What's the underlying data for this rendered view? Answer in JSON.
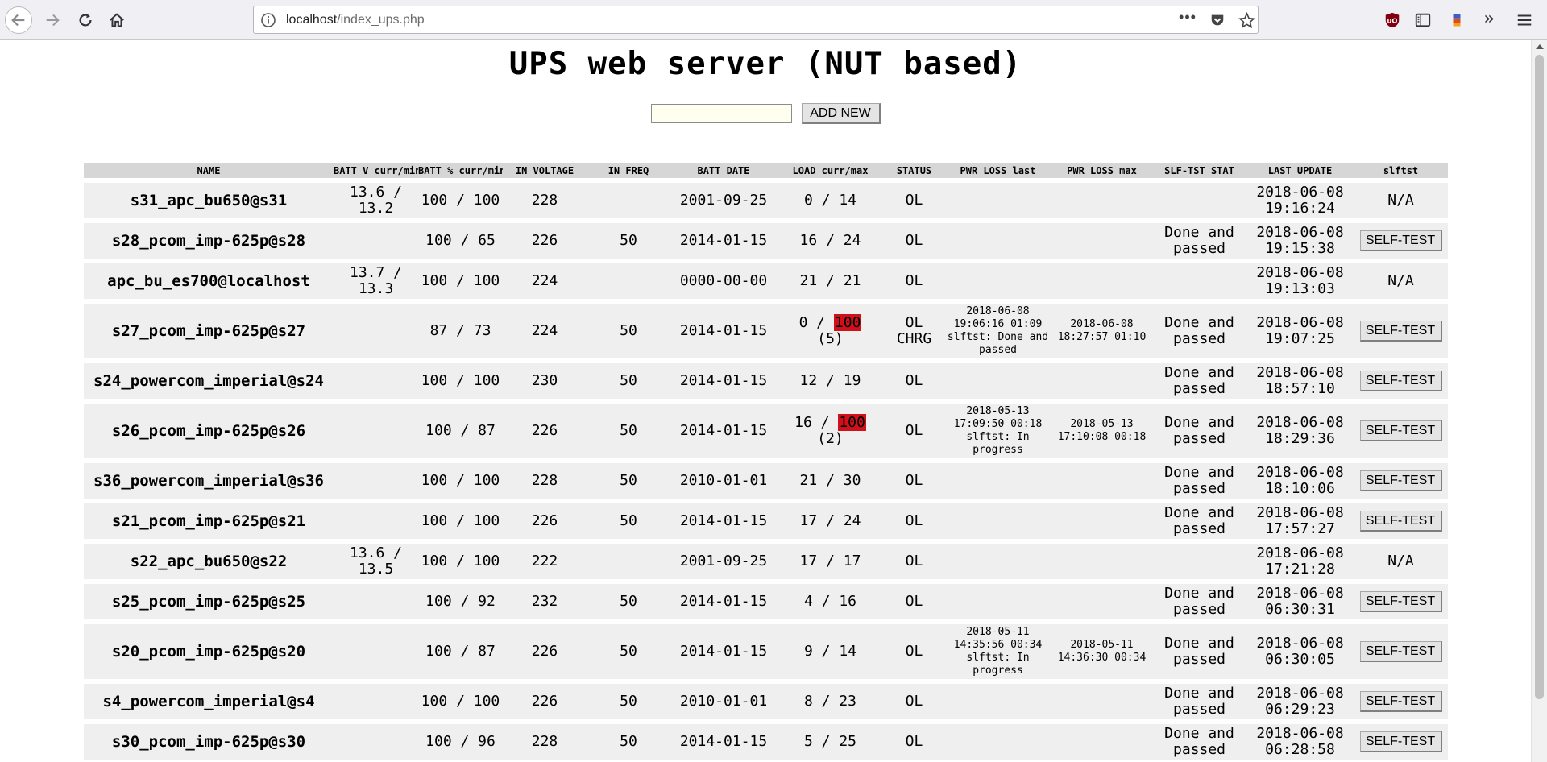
{
  "browser": {
    "url_host": "localhost",
    "url_path": "/index_ups.php"
  },
  "page": {
    "title": "UPS web server (NUT based)",
    "add_input_value": "",
    "add_button": "ADD NEW"
  },
  "columns": [
    "NAME",
    "BATT V curr/min",
    "BATT % curr/min",
    "IN VOLTAGE",
    "IN FREQ",
    "BATT DATE",
    "LOAD curr/max",
    "STATUS",
    "PWR LOSS last",
    "PWR LOSS max",
    "SLF-TST STAT",
    "LAST UPDATE",
    "slftst"
  ],
  "rows": [
    {
      "name": "s31_apc_bu650@s31",
      "batt_v": [
        "13.6 /",
        "13.2"
      ],
      "batt_pct": "100 / 100",
      "in_voltage": "228",
      "in_freq": "",
      "batt_date": "2001-09-25",
      "load_cur": "0",
      "load_max": "14",
      "load_max_alert": false,
      "load_extra": "",
      "status": "OL",
      "pwr_last": [],
      "pwr_max": [],
      "slftst_stat": [],
      "last_update": [
        "2018-06-08",
        "19:16:24"
      ],
      "slftst": "N/A"
    },
    {
      "name": "s28_pcom_imp-625p@s28",
      "batt_v": [],
      "batt_pct": "100 / 65",
      "in_voltage": "226",
      "in_freq": "50",
      "batt_date": "2014-01-15",
      "load_cur": "16",
      "load_max": "24",
      "load_max_alert": false,
      "load_extra": "",
      "status": "OL",
      "pwr_last": [],
      "pwr_max": [],
      "slftst_stat": [
        "Done and",
        "passed"
      ],
      "last_update": [
        "2018-06-08",
        "19:15:38"
      ],
      "slftst": "SELF-TEST"
    },
    {
      "name": "apc_bu_es700@localhost",
      "batt_v": [
        "13.7 /",
        "13.3"
      ],
      "batt_pct": "100 / 100",
      "in_voltage": "224",
      "in_freq": "",
      "batt_date": "0000-00-00",
      "load_cur": "21",
      "load_max": "21",
      "load_max_alert": false,
      "load_extra": "",
      "status": "OL",
      "pwr_last": [],
      "pwr_max": [],
      "slftst_stat": [],
      "last_update": [
        "2018-06-08",
        "19:13:03"
      ],
      "slftst": "N/A"
    },
    {
      "name": "s27_pcom_imp-625p@s27",
      "batt_v": [],
      "batt_pct": "87 / 73",
      "in_voltage": "224",
      "in_freq": "50",
      "batt_date": "2014-01-15",
      "load_cur": "0",
      "load_max": "100",
      "load_max_alert": true,
      "load_extra": "(5)",
      "status": "OL CHRG",
      "pwr_last": [
        "2018-06-08",
        "19:06:16 01:09",
        "slftst: Done and",
        "passed"
      ],
      "pwr_max": [
        "2018-06-08",
        "18:27:57 01:10"
      ],
      "slftst_stat": [
        "Done and",
        "passed"
      ],
      "last_update": [
        "2018-06-08",
        "19:07:25"
      ],
      "slftst": "SELF-TEST"
    },
    {
      "name": "s24_powercom_imperial@s24",
      "batt_v": [],
      "batt_pct": "100 / 100",
      "in_voltage": "230",
      "in_freq": "50",
      "batt_date": "2014-01-15",
      "load_cur": "12",
      "load_max": "19",
      "load_max_alert": false,
      "load_extra": "",
      "status": "OL",
      "pwr_last": [],
      "pwr_max": [],
      "slftst_stat": [
        "Done and",
        "passed"
      ],
      "last_update": [
        "2018-06-08",
        "18:57:10"
      ],
      "slftst": "SELF-TEST"
    },
    {
      "name": "s26_pcom_imp-625p@s26",
      "batt_v": [],
      "batt_pct": "100 / 87",
      "in_voltage": "226",
      "in_freq": "50",
      "batt_date": "2014-01-15",
      "load_cur": "16",
      "load_max": "100",
      "load_max_alert": true,
      "load_extra": "(2)",
      "status": "OL",
      "pwr_last": [
        "2018-05-13",
        "17:09:50 00:18",
        "slftst: In",
        "progress"
      ],
      "pwr_max": [
        "2018-05-13",
        "17:10:08 00:18"
      ],
      "slftst_stat": [
        "Done and",
        "passed"
      ],
      "last_update": [
        "2018-06-08",
        "18:29:36"
      ],
      "slftst": "SELF-TEST"
    },
    {
      "name": "s36_powercom_imperial@s36",
      "batt_v": [],
      "batt_pct": "100 / 100",
      "in_voltage": "228",
      "in_freq": "50",
      "batt_date": "2010-01-01",
      "load_cur": "21",
      "load_max": "30",
      "load_max_alert": false,
      "load_extra": "",
      "status": "OL",
      "pwr_last": [],
      "pwr_max": [],
      "slftst_stat": [
        "Done and",
        "passed"
      ],
      "last_update": [
        "2018-06-08",
        "18:10:06"
      ],
      "slftst": "SELF-TEST"
    },
    {
      "name": "s21_pcom_imp-625p@s21",
      "batt_v": [],
      "batt_pct": "100 / 100",
      "in_voltage": "226",
      "in_freq": "50",
      "batt_date": "2014-01-15",
      "load_cur": "17",
      "load_max": "24",
      "load_max_alert": false,
      "load_extra": "",
      "status": "OL",
      "pwr_last": [],
      "pwr_max": [],
      "slftst_stat": [
        "Done and",
        "passed"
      ],
      "last_update": [
        "2018-06-08",
        "17:57:27"
      ],
      "slftst": "SELF-TEST"
    },
    {
      "name": "s22_apc_bu650@s22",
      "batt_v": [
        "13.6 /",
        "13.5"
      ],
      "batt_pct": "100 / 100",
      "in_voltage": "222",
      "in_freq": "",
      "batt_date": "2001-09-25",
      "load_cur": "17",
      "load_max": "17",
      "load_max_alert": false,
      "load_extra": "",
      "status": "OL",
      "pwr_last": [],
      "pwr_max": [],
      "slftst_stat": [],
      "last_update": [
        "2018-06-08",
        "17:21:28"
      ],
      "slftst": "N/A"
    },
    {
      "name": "s25_pcom_imp-625p@s25",
      "batt_v": [],
      "batt_pct": "100 / 92",
      "in_voltage": "232",
      "in_freq": "50",
      "batt_date": "2014-01-15",
      "load_cur": "4",
      "load_max": "16",
      "load_max_alert": false,
      "load_extra": "",
      "status": "OL",
      "pwr_last": [],
      "pwr_max": [],
      "slftst_stat": [
        "Done and",
        "passed"
      ],
      "last_update": [
        "2018-06-08",
        "06:30:31"
      ],
      "slftst": "SELF-TEST"
    },
    {
      "name": "s20_pcom_imp-625p@s20",
      "batt_v": [],
      "batt_pct": "100 / 87",
      "in_voltage": "226",
      "in_freq": "50",
      "batt_date": "2014-01-15",
      "load_cur": "9",
      "load_max": "14",
      "load_max_alert": false,
      "load_extra": "",
      "status": "OL",
      "pwr_last": [
        "2018-05-11",
        "14:35:56 00:34",
        "slftst: In",
        "progress"
      ],
      "pwr_max": [
        "2018-05-11",
        "14:36:30 00:34"
      ],
      "slftst_stat": [
        "Done and",
        "passed"
      ],
      "last_update": [
        "2018-06-08",
        "06:30:05"
      ],
      "slftst": "SELF-TEST"
    },
    {
      "name": "s4_powercom_imperial@s4",
      "batt_v": [],
      "batt_pct": "100 / 100",
      "in_voltage": "226",
      "in_freq": "50",
      "batt_date": "2010-01-01",
      "load_cur": "8",
      "load_max": "23",
      "load_max_alert": false,
      "load_extra": "",
      "status": "OL",
      "pwr_last": [],
      "pwr_max": [],
      "slftst_stat": [
        "Done and",
        "passed"
      ],
      "last_update": [
        "2018-06-08",
        "06:29:23"
      ],
      "slftst": "SELF-TEST"
    },
    {
      "name": "s30_pcom_imp-625p@s30",
      "batt_v": [],
      "batt_pct": "100 / 96",
      "in_voltage": "228",
      "in_freq": "50",
      "batt_date": "2014-01-15",
      "load_cur": "5",
      "load_max": "25",
      "load_max_alert": false,
      "load_extra": "",
      "status": "OL",
      "pwr_last": [],
      "pwr_max": [],
      "slftst_stat": [
        "Done and",
        "passed"
      ],
      "last_update": [
        "2018-06-08",
        "06:28:58"
      ],
      "slftst": "SELF-TEST"
    }
  ],
  "colors": {
    "alert_bg": "#d0101a",
    "row_bg": "#efefef",
    "header_bg": "#d6d6d6"
  }
}
